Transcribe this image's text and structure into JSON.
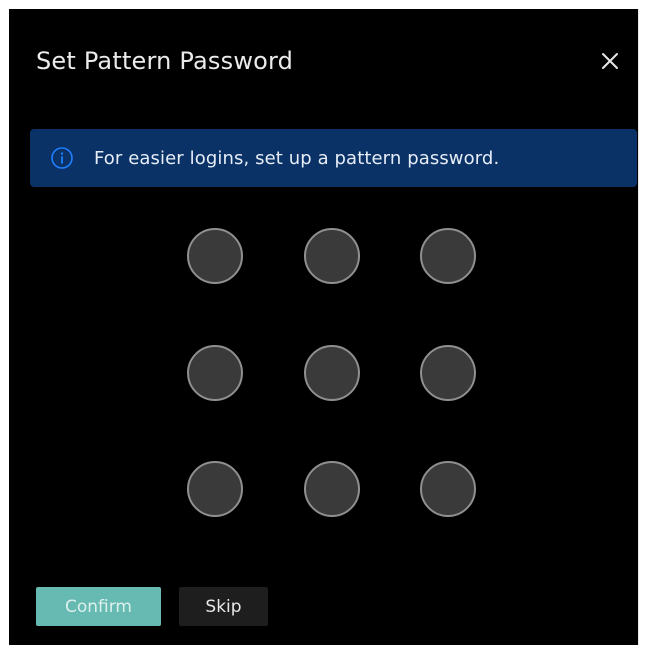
{
  "dialog": {
    "title": "Set Pattern Password",
    "close_icon": "close-icon"
  },
  "banner": {
    "icon": "info-icon",
    "text": "For easier logins, set up a pattern password.",
    "background": "#0a3266",
    "icon_color": "#1e7fff"
  },
  "pattern": {
    "rows": 3,
    "cols": 3,
    "dot_fill": "#3a3a3a",
    "dot_border": "#8f8f8f"
  },
  "footer": {
    "confirm_label": "Confirm",
    "skip_label": "Skip",
    "confirm_color": "#66bab1"
  }
}
